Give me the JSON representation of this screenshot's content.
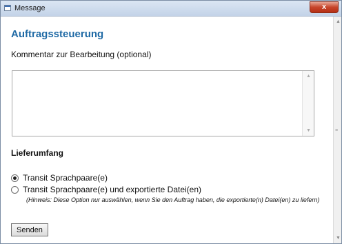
{
  "window": {
    "title": "Message",
    "close_label": "x"
  },
  "form": {
    "heading": "Auftragssteuerung",
    "comment_label": "Kommentar zur Bearbeitung (optional)",
    "comment_value": "",
    "scope_heading": "Lieferumfang",
    "options": [
      {
        "label": "Transit Sprachpaare(e)",
        "selected": true
      },
      {
        "label": "Transit Sprachpaare(e) und exportierte Datei(en)",
        "selected": false
      }
    ],
    "hint": "(Hinweis: Diese Option nur auswählen, wenn Sie den Auftrag haben, die exportierte(n) Datei(en) zu liefern)",
    "submit_label": "Senden"
  }
}
